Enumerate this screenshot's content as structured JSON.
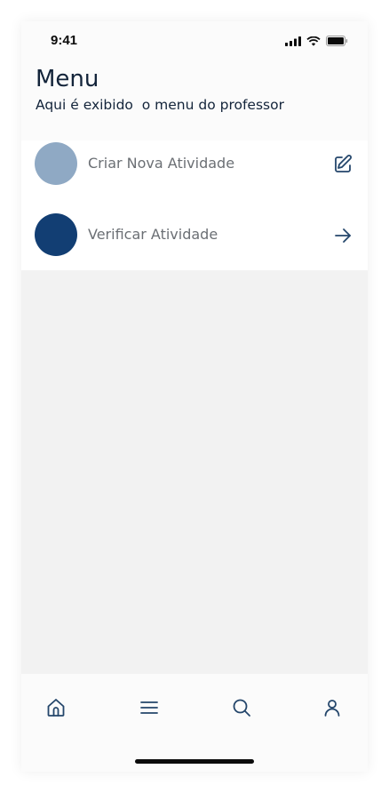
{
  "status_bar": {
    "time": "9:41"
  },
  "header": {
    "title": "Menu",
    "subtitle": "Aqui é exibido  o menu do professor"
  },
  "menu": {
    "items": [
      {
        "label": "Criar Nova Atividade",
        "avatar_color": "#8fa9c4",
        "action_icon": "edit-icon"
      },
      {
        "label": "Verificar Atividade",
        "avatar_color": "#123e73",
        "action_icon": "arrow-right-icon"
      }
    ]
  },
  "tab_bar": {
    "tabs": [
      {
        "icon": "home-icon"
      },
      {
        "icon": "menu-icon"
      },
      {
        "icon": "search-icon"
      },
      {
        "icon": "user-icon"
      }
    ]
  },
  "colors": {
    "text_primary": "#13243a",
    "text_secondary": "#6b6f74",
    "icon": "#24466b",
    "content_background": "#f2f2f2"
  }
}
